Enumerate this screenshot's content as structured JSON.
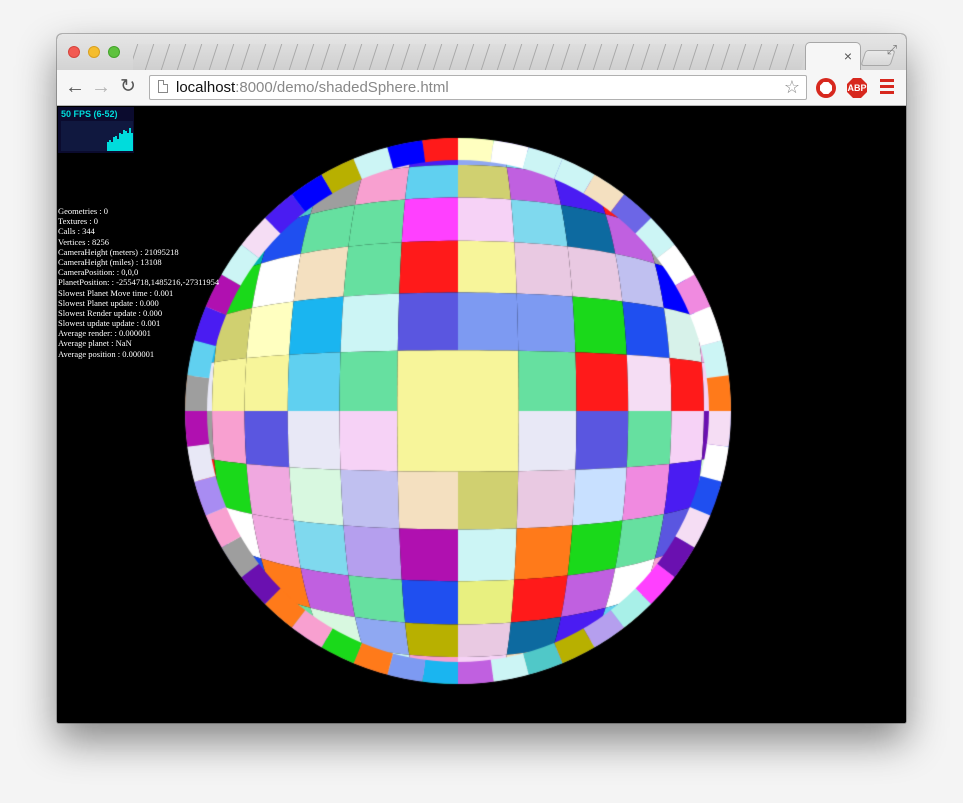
{
  "window": {
    "background_tab_glyphs": [
      "",
      "",
      "",
      "",
      "",
      "",
      "",
      "",
      "",
      "",
      "",
      "",
      "",
      "",
      "",
      "",
      "",
      "",
      "",
      "",
      "",
      "",
      "",
      "",
      "",
      "",
      "",
      "",
      "",
      "",
      "",
      "",
      "",
      "",
      "",
      "",
      "",
      "",
      "",
      "",
      "",
      ""
    ],
    "active_tab_close": "×"
  },
  "toolbar": {
    "url_host": "localhost",
    "url_rest": ":8000/demo/shadedSphere.html",
    "icons": [
      "back-arrow-icon",
      "forward-arrow-icon",
      "reload-icon",
      "page-icon",
      "bookmark-star-icon",
      "stop-extension-icon",
      "adblock-plus-icon",
      "chrome-menu-icon"
    ],
    "abp_label": "ABP"
  },
  "fps": {
    "label": "50 FPS (6-52)",
    "graph_levels": [
      0.3,
      0.35,
      0.3,
      0.45,
      0.5,
      0.4,
      0.6,
      0.55,
      0.7,
      0.65,
      0.6,
      0.75,
      0.6
    ],
    "color": "#00dcdc"
  },
  "stats": {
    "lines": [
      "Geometries : 0",
      "Textures : 0",
      "Calls : 344",
      "Vertices : 8256",
      "CameraHeight (meters) : 21095218",
      "CameraHeight (miles) : 13108",
      "CameraPosition: : 0,0,0",
      "PlanetPosition: : -2554718,1485216,-27311954",
      "Slowest Planet Move time : 0.001",
      "Slowest Planet update : 0.000",
      "Slowest Render update : 0.000",
      "Slowest update update : 0.001",
      "Average render: : 0.000001",
      "Average planet : NaN",
      "Average position : 0.000001"
    ]
  },
  "sphere": {
    "palette": [
      "#f7f59a",
      "#4a1cf2",
      "#ffffff",
      "#1f4ff0",
      "#a88cf2",
      "#f0a8e0",
      "#d7f2ea",
      "#6c66e6",
      "#7fd9ee",
      "#8fa8f2",
      "#e9c9e2",
      "#b59fee",
      "#f5ddf4",
      "#6a10b0",
      "#d0d070",
      "#b8b000",
      "#7d9af2",
      "#a8f0e8",
      "#0d6aa0",
      "#f6d2f6",
      "#5a56e0",
      "#c0c0f0",
      "#e8e8f6",
      "#ccf5f5",
      "#9e9e9e",
      "#00b0b0",
      "#f4e0c0",
      "#ff1a1a",
      "#1ad91a",
      "#b010b0",
      "#66e0a0",
      "#ffffc0",
      "#ff7a1a",
      "#1ab5f0",
      "#c8e0ff",
      "#d8f8e0",
      "#f08ae0",
      "#0000ff",
      "#ff40ff",
      "#50c8c8",
      "#e8f080",
      "#c060e0",
      "#60d0f0",
      "#f8a0d0"
    ]
  }
}
